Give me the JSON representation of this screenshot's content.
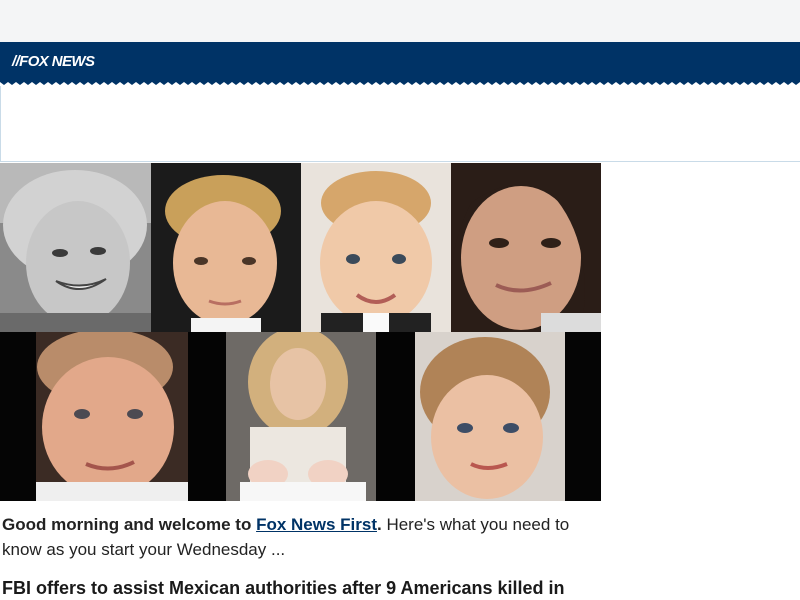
{
  "header": {
    "logo_text": "FOX NEWS",
    "brand_color": "#003366"
  },
  "hero": {
    "photos": [
      {
        "name": "photo-woman-grayscale-smiling"
      },
      {
        "name": "photo-blond-boy"
      },
      {
        "name": "photo-toddler-boy"
      },
      {
        "name": "photo-dark-haired-woman"
      },
      {
        "name": "photo-freckled-boy"
      },
      {
        "name": "photo-woman-with-twin-babies"
      },
      {
        "name": "photo-young-girl"
      }
    ]
  },
  "intro": {
    "lead": "Good morning and welcome to ",
    "link_label": "Fox News First",
    "period": ".",
    "rest": " Here's what you need to know as you start your Wednesday ..."
  },
  "headline": {
    "text": "FBI offers to assist Mexican authorities after 9 Americans killed in"
  }
}
